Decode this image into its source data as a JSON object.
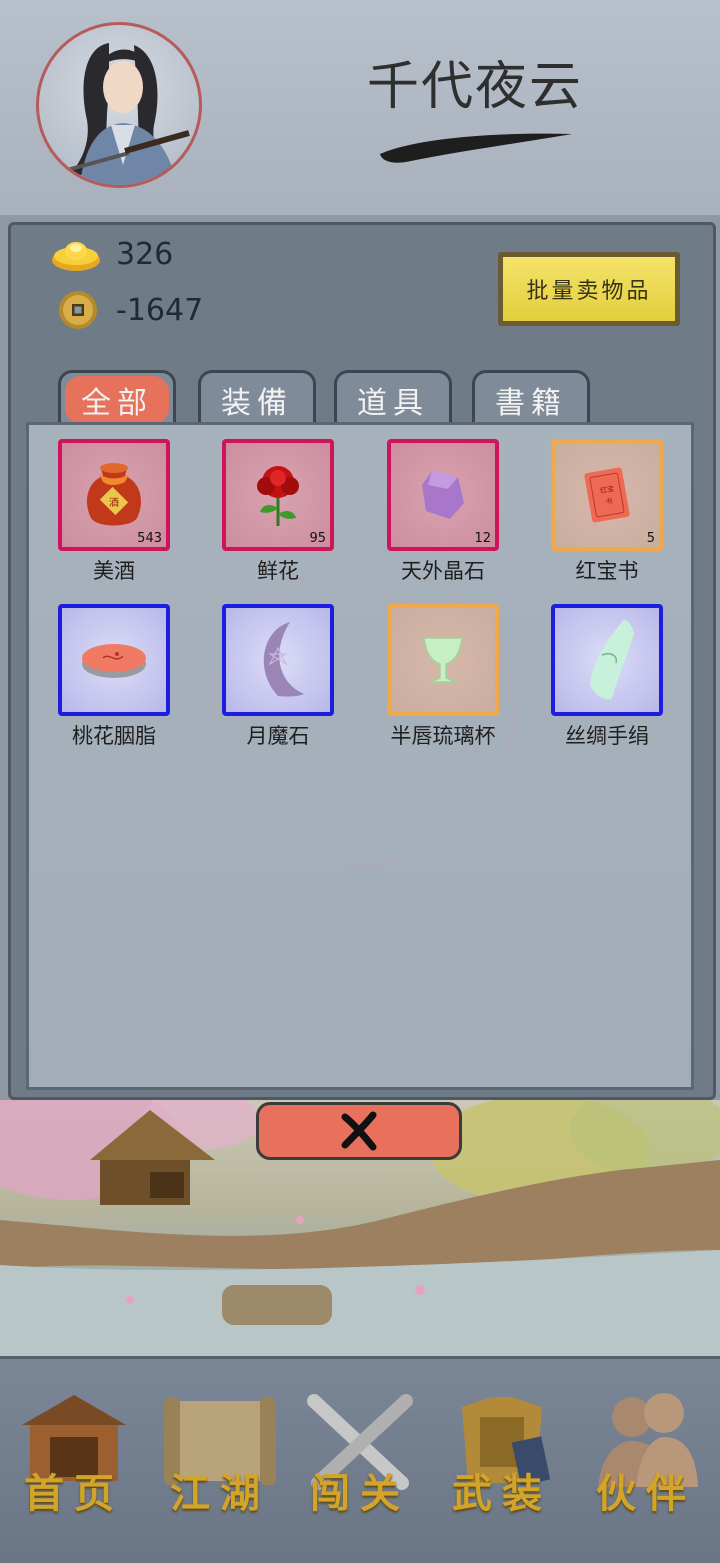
{
  "player": {
    "name": "千代夜云"
  },
  "currencies": {
    "gold_ingot": {
      "icon": "gold-ingot-icon",
      "amount": "326"
    },
    "copper_coin": {
      "icon": "copper-coin-icon",
      "amount": "-1647"
    }
  },
  "sell_button": {
    "label": "批量卖物品"
  },
  "tabs": [
    {
      "label": "全部",
      "active": true
    },
    {
      "label": "装備",
      "active": false
    },
    {
      "label": "道具",
      "active": false
    },
    {
      "label": "書籍",
      "active": false
    }
  ],
  "items": [
    {
      "name": "美酒",
      "count": "543",
      "rarity": "red",
      "icon": "wine-jar-icon"
    },
    {
      "name": "鲜花",
      "count": "95",
      "rarity": "red",
      "icon": "rose-icon"
    },
    {
      "name": "天外晶石",
      "count": "12",
      "rarity": "red",
      "icon": "crystal-icon"
    },
    {
      "name": "红宝书",
      "count": "5",
      "rarity": "orange",
      "icon": "red-book-icon"
    },
    {
      "name": "桃花胭脂",
      "count": "",
      "rarity": "blue",
      "icon": "rouge-icon"
    },
    {
      "name": "月魔石",
      "count": "",
      "rarity": "blue",
      "icon": "moon-stone-icon"
    },
    {
      "name": "半唇琉璃杯",
      "count": "",
      "rarity": "orange",
      "icon": "glass-cup-icon"
    },
    {
      "name": "丝绸手绢",
      "count": "",
      "rarity": "blue",
      "icon": "silk-handkerchief-icon"
    }
  ],
  "nav": [
    {
      "label": "首页",
      "icon": "house-icon"
    },
    {
      "label": "江湖",
      "icon": "scroll-icon"
    },
    {
      "label": "闯关",
      "icon": "crossed-swords-icon"
    },
    {
      "label": "武装",
      "icon": "armor-icon"
    },
    {
      "label": "伙伴",
      "icon": "companions-icon"
    }
  ],
  "colors": {
    "rarity_red": "#d0145a",
    "rarity_orange": "#f0a848",
    "rarity_blue": "#1d1de0",
    "accent": "#e8715e",
    "nav_text": "#d4a429"
  }
}
